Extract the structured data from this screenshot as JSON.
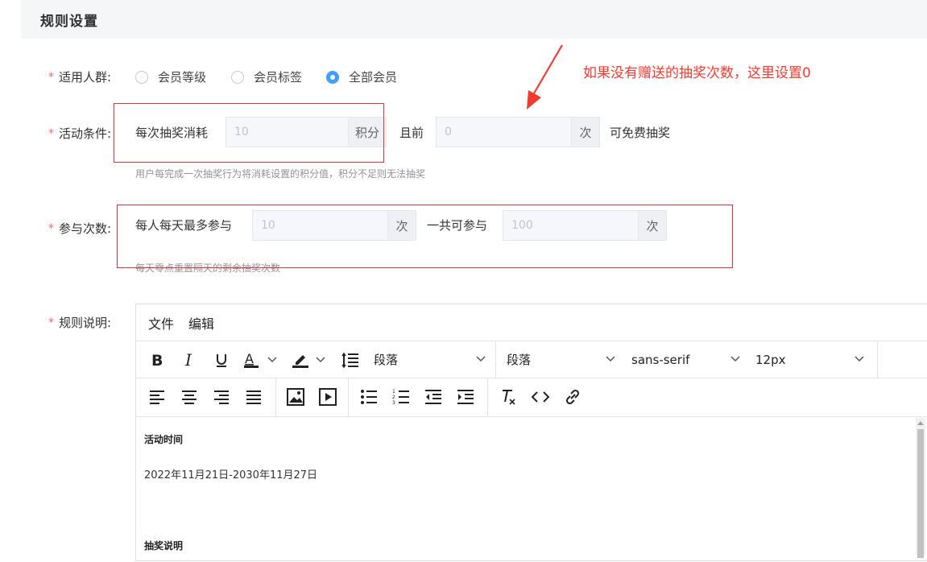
{
  "header": {
    "title": "规则设置"
  },
  "required_mark": "*",
  "audience": {
    "label": "适用人群:",
    "options": [
      {
        "label": "会员等级",
        "checked": false
      },
      {
        "label": "会员标签",
        "checked": false
      },
      {
        "label": "全部会员",
        "checked": true
      }
    ]
  },
  "condition": {
    "label": "活动条件:",
    "prefix": "每次抽奖消耗",
    "points_placeholder": "10",
    "points_unit": "积分",
    "mid": "且前",
    "free_placeholder": "0",
    "free_unit": "次",
    "suffix": "可免费抽奖",
    "hint": "用户每完成一次抽奖行为将消耗设置的积分值，积分不足则无法抽奖"
  },
  "participation": {
    "label": "参与次数:",
    "daily_prefix": "每人每天最多参与",
    "daily_placeholder": "10",
    "daily_unit": "次",
    "total_prefix": "一共可参与",
    "total_placeholder": "100",
    "total_unit": "次",
    "hint": "每天零点重置隔天的剩余抽奖次数"
  },
  "annotation": "如果没有赠送的抽奖次数，这里设置0",
  "rules": {
    "label": "规则说明:",
    "menu": [
      "文件",
      "编辑"
    ],
    "block_format": "段落",
    "paragraph": "段落",
    "font_family": "sans-serif",
    "font_size": "12px",
    "content": {
      "heading1": "活动时间",
      "line1": "2022年11月21日-2030年11月27日",
      "heading2": "抽奖说明"
    }
  },
  "colors": {
    "accent": "#409eff",
    "required": "#f56c6c",
    "annotation": "#f23b30"
  }
}
